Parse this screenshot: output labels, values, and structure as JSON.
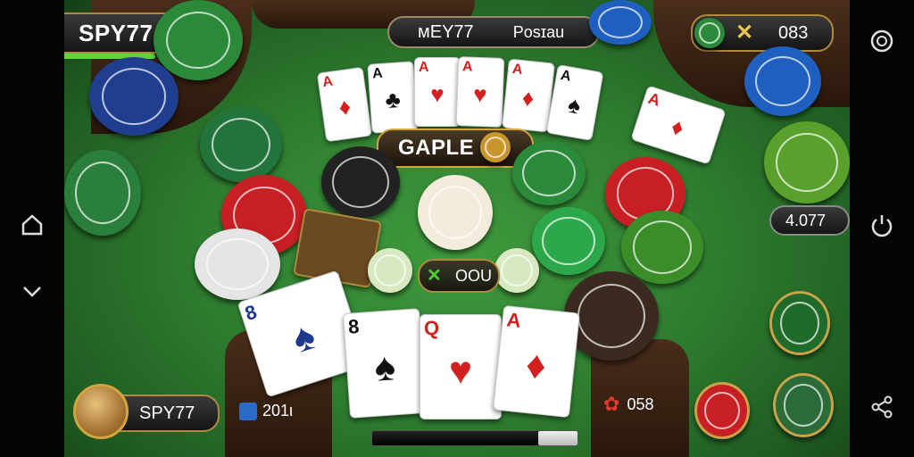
{
  "player_top": {
    "name": "SPY77",
    "progress": 0.6
  },
  "opponent_top": {
    "name": "ᴍEY77",
    "status": "Posɪau"
  },
  "score_top_right": {
    "value": "083"
  },
  "gaple_badge": {
    "label": "GAPLE"
  },
  "center_pot": {
    "value": "ООU"
  },
  "right_value": {
    "value": "4.077"
  },
  "player_bottom": {
    "name": "SPY77"
  },
  "bottom_left_value": {
    "value": "201ι"
  },
  "bottom_right_value": {
    "value": "058"
  },
  "top_cards": [
    {
      "rank": "A",
      "suit": "♦",
      "color": "red"
    },
    {
      "rank": "A",
      "suit": "♣",
      "color": "blk"
    },
    {
      "rank": "A",
      "suit": "♥",
      "color": "red"
    },
    {
      "rank": "A",
      "suit": "♥",
      "color": "red"
    },
    {
      "rank": "A",
      "suit": "♦",
      "color": "red"
    },
    {
      "rank": "A",
      "suit": "♠",
      "color": "blk"
    }
  ],
  "bottom_cards": [
    {
      "rank": "8",
      "suit": "♠",
      "color": "blu"
    },
    {
      "rank": "8",
      "suit": "♠",
      "color": "blk"
    },
    {
      "rank": "Q",
      "suit": "♥",
      "color": "red"
    },
    {
      "rank": "A",
      "suit": "♦",
      "color": "red"
    }
  ],
  "colors": {
    "felt": "#2f7e30",
    "gold": "#d4a53c",
    "chip_red": "#c71f24",
    "chip_green": "#2a8a3a",
    "chip_blue": "#1f5fbf"
  },
  "icons": {
    "left_system": [
      "home-icon",
      "chevron-down-icon"
    ],
    "right_system": [
      "refresh-icon",
      "power-icon",
      "share-icon"
    ]
  }
}
